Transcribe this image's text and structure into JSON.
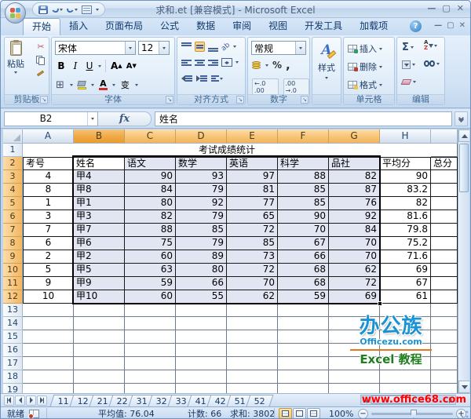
{
  "title_bar": {
    "title": "求和.et [兼容模式] - Microsoft Excel"
  },
  "ribbon_tabs": [
    {
      "label": "开始",
      "active": true
    },
    {
      "label": "插入",
      "active": false
    },
    {
      "label": "页面布局",
      "active": false
    },
    {
      "label": "公式",
      "active": false
    },
    {
      "label": "数据",
      "active": false
    },
    {
      "label": "审阅",
      "active": false
    },
    {
      "label": "视图",
      "active": false
    },
    {
      "label": "开发工具",
      "active": false
    },
    {
      "label": "加载项",
      "active": false
    }
  ],
  "ribbon": {
    "clipboard": {
      "group_label": "剪贴板",
      "paste_label": "粘贴"
    },
    "font": {
      "group_label": "字体",
      "font_name": "宋体",
      "font_size": "12",
      "bold": "B",
      "italic": "I",
      "underline": "U",
      "phonetic": "变"
    },
    "alignment": {
      "group_label": "对齐方式"
    },
    "number": {
      "group_label": "数字",
      "format": "常规",
      "percent": "%",
      "comma": ",",
      "inc_decimal": "←.0 .00",
      "dec_decimal": ".00 →.0"
    },
    "styles": {
      "group_label": "",
      "button_label": "样式",
      "icon_letter": "A"
    },
    "cells": {
      "group_label": "单元格",
      "insert": "插入",
      "delete": "删除",
      "format": "格式"
    },
    "editing": {
      "group_label": "编辑",
      "autosum": "Σ",
      "sort_a": "A",
      "sort_z": "Z"
    }
  },
  "formula_bar": {
    "name_box": "B2",
    "fx": "fx",
    "value": "姓名"
  },
  "sheet": {
    "visible_columns": [
      "A",
      "B",
      "C",
      "D",
      "E",
      "F",
      "G",
      "H"
    ],
    "title_row_text": "考试成绩统计",
    "headers": [
      "考号",
      "姓名",
      "语文",
      "数学",
      "英语",
      "科学",
      "品社",
      "平均分",
      "总分"
    ],
    "rows": [
      [
        "4",
        "甲4",
        "90",
        "93",
        "97",
        "88",
        "82",
        "90",
        ""
      ],
      [
        "8",
        "甲8",
        "84",
        "79",
        "81",
        "85",
        "87",
        "83.2",
        ""
      ],
      [
        "1",
        "甲1",
        "80",
        "92",
        "77",
        "85",
        "76",
        "82",
        ""
      ],
      [
        "3",
        "甲3",
        "82",
        "79",
        "65",
        "90",
        "92",
        "81.6",
        ""
      ],
      [
        "7",
        "甲7",
        "88",
        "85",
        "72",
        "70",
        "84",
        "79.8",
        ""
      ],
      [
        "6",
        "甲6",
        "75",
        "79",
        "85",
        "67",
        "70",
        "75.2",
        ""
      ],
      [
        "2",
        "甲2",
        "60",
        "89",
        "73",
        "66",
        "70",
        "71.6",
        ""
      ],
      [
        "5",
        "甲5",
        "63",
        "80",
        "72",
        "68",
        "62",
        "69",
        ""
      ],
      [
        "9",
        "甲9",
        "59",
        "66",
        "70",
        "68",
        "72",
        "67",
        ""
      ],
      [
        "10",
        "甲10",
        "60",
        "55",
        "62",
        "59",
        "69",
        "61",
        ""
      ]
    ],
    "visible_row_count": 19,
    "selection": {
      "range": "B2:G12",
      "active_cell": "B2"
    }
  },
  "watermark": {
    "title": "办公族",
    "site": "Officezu.com",
    "caption": "Excel 教程"
  },
  "bottom": {
    "sheet_tabs": [
      "11",
      "12",
      "21",
      "22",
      "31",
      "32",
      "33",
      "41",
      "42",
      "51",
      "52"
    ],
    "url": "www.office68.com"
  },
  "status_bar": {
    "mode": "就绪",
    "average_label": "平均值: 76.04",
    "count_label": "计数: 66",
    "sum_label": "求和: 3802",
    "zoom_level": "100%"
  },
  "colors": {
    "header_selected": "#F5B65F",
    "header_active_col": "#EFA843",
    "selection_fill": "#E2E6F3",
    "table_border": "#191919",
    "gridline": "#6E7B8A",
    "watermark_blue": "#1A93D6",
    "watermark_green": "#1E7E1E",
    "url_red": "#FF0000"
  }
}
